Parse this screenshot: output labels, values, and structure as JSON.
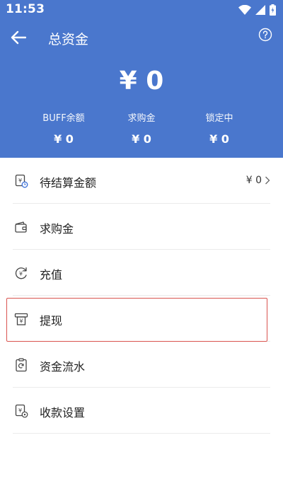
{
  "status_bar": {
    "time": "11:53"
  },
  "appbar": {
    "title": "总资金",
    "back_icon": "arrow-left-icon",
    "help_icon": "help-circle-icon"
  },
  "total": {
    "amount": "¥ 0"
  },
  "stats": [
    {
      "label": "BUFF余额",
      "value": "¥ 0"
    },
    {
      "label": "求购金",
      "value": "¥ 0"
    },
    {
      "label": "锁定中",
      "value": "¥ 0"
    }
  ],
  "menu": [
    {
      "label": "待结算金额",
      "value": "¥ 0",
      "icon": "pending-settlement-icon"
    },
    {
      "label": "求购金",
      "icon": "wallet-icon"
    },
    {
      "label": "充值",
      "icon": "recharge-icon"
    },
    {
      "label": "提现",
      "icon": "withdraw-icon"
    },
    {
      "label": "资金流水",
      "icon": "transaction-history-icon"
    },
    {
      "label": "收款设置",
      "icon": "payment-settings-icon"
    }
  ],
  "colors": {
    "header_bg": "#4a77cd",
    "highlight_border": "#d9534f"
  }
}
